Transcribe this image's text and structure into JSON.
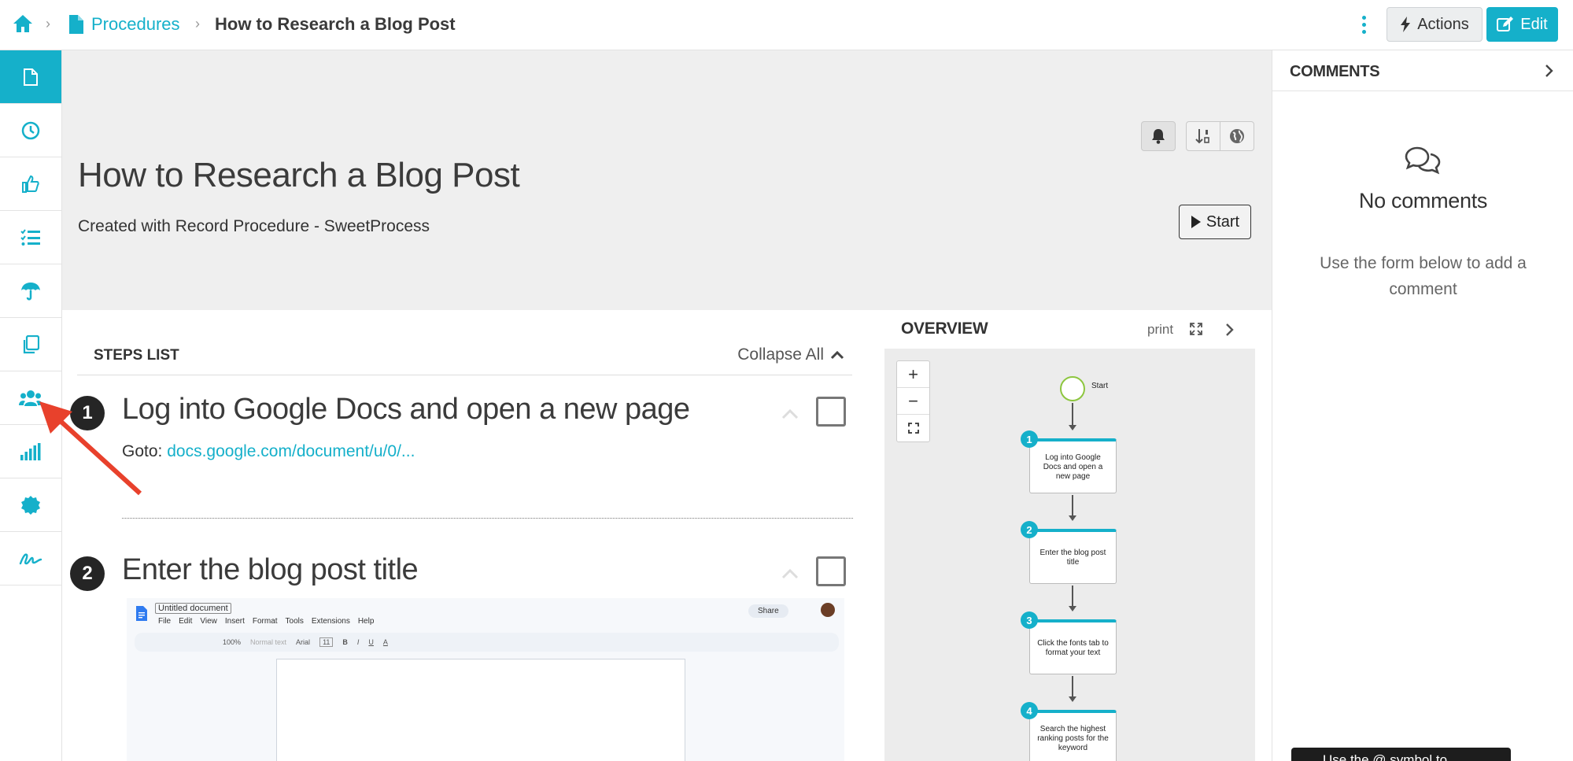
{
  "breadcrumb": {
    "procedures": "Procedures",
    "current": "How to Research a Blog Post",
    "separator": "›"
  },
  "toolbar": {
    "actions_label": "Actions",
    "edit_label": "Edit"
  },
  "sidebar": {
    "items": [
      {
        "icon": "document-icon",
        "active": true
      },
      {
        "icon": "clock-icon"
      },
      {
        "icon": "thumbs-up-icon"
      },
      {
        "icon": "checklist-icon"
      },
      {
        "icon": "umbrella-icon"
      },
      {
        "icon": "copy-icon"
      },
      {
        "icon": "team-icon"
      },
      {
        "icon": "signal-bars-icon"
      },
      {
        "icon": "badge-icon"
      },
      {
        "icon": "signature-icon"
      }
    ]
  },
  "procedure": {
    "title": "How to Research a Blog Post",
    "subtitle": "Created with Record Procedure - SweetProcess",
    "start_label": "Start"
  },
  "steps_list": {
    "label": "STEPS LIST",
    "collapse_label": "Collapse All",
    "steps": [
      {
        "number": "1",
        "title": "Log into Google Docs and open a new page",
        "goto_label": "Goto:",
        "goto_link": "docs.google.com/document/u/0/..."
      },
      {
        "number": "2",
        "title": "Enter the blog post title"
      }
    ]
  },
  "doc_screenshot": {
    "doc_title": "Untitled document",
    "menu": [
      "File",
      "Edit",
      "View",
      "Insert",
      "Format",
      "Tools",
      "Extensions",
      "Help"
    ],
    "share_label": "Share",
    "zoom": "100%",
    "style": "Normal text",
    "font": "Arial",
    "font_size": "11"
  },
  "overview": {
    "title": "OVERVIEW",
    "print_label": "print",
    "start_label": "Start",
    "nodes": [
      {
        "number": "1",
        "text": "Log into Google Docs and open a new page"
      },
      {
        "number": "2",
        "text": "Enter the blog post title"
      },
      {
        "number": "3",
        "text": "Click the fonts tab to format your text"
      },
      {
        "number": "4",
        "text": "Search the highest ranking posts for the keyword"
      }
    ]
  },
  "comments": {
    "title": "COMMENTS",
    "empty_title": "No comments",
    "empty_hint": "Use the form below to add a comment",
    "toast_text": "Use the @ symbol to"
  },
  "colors": {
    "accent": "#15b0ca",
    "annotation_arrow": "#e8412c"
  }
}
